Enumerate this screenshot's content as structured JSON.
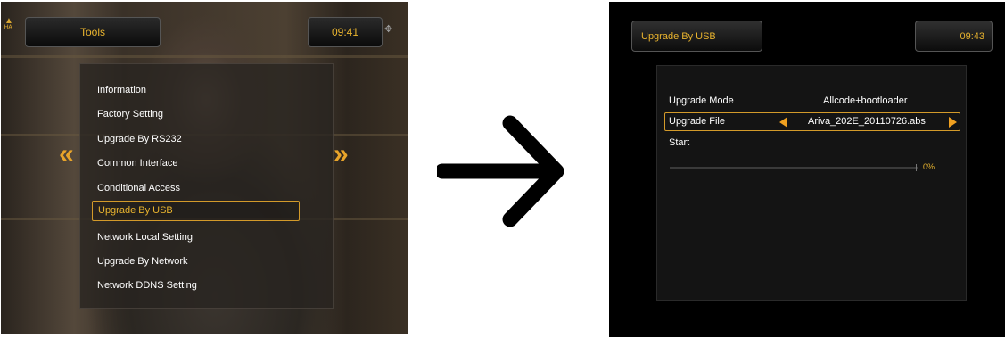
{
  "left_screen": {
    "header_title": "Tools",
    "clock": "09:41",
    "corner_label": "ф",
    "logo_label": "A\nHA",
    "nav_left": "«",
    "nav_right": "»",
    "menu": [
      {
        "label": "Information",
        "selected": false
      },
      {
        "label": "Factory Setting",
        "selected": false
      },
      {
        "label": "Upgrade By RS232",
        "selected": false
      },
      {
        "label": "Common Interface",
        "selected": false
      },
      {
        "label": "Conditional Access",
        "selected": false
      },
      {
        "label": "Upgrade By USB",
        "selected": true
      },
      {
        "label": "Network Local Setting",
        "selected": false
      },
      {
        "label": "Upgrade By Network",
        "selected": false
      },
      {
        "label": "Network DDNS Setting",
        "selected": false
      }
    ]
  },
  "arrow": {
    "icon": "arrow-right-icon"
  },
  "right_screen": {
    "header_title": "Upgrade By USB",
    "clock": "09:43",
    "upgrade_mode_label": "Upgrade Mode",
    "upgrade_mode_value": "Allcode+bootloader",
    "upgrade_file_label": "Upgrade File",
    "upgrade_file_value": "Ariva_202E_20110726.abs",
    "start_label": "Start",
    "progress": 0,
    "progress_text": "0%"
  },
  "colors": {
    "accent": "#e8b32e",
    "selection_border": "#d39a2a",
    "arrow_triangle": "#f0a020"
  }
}
